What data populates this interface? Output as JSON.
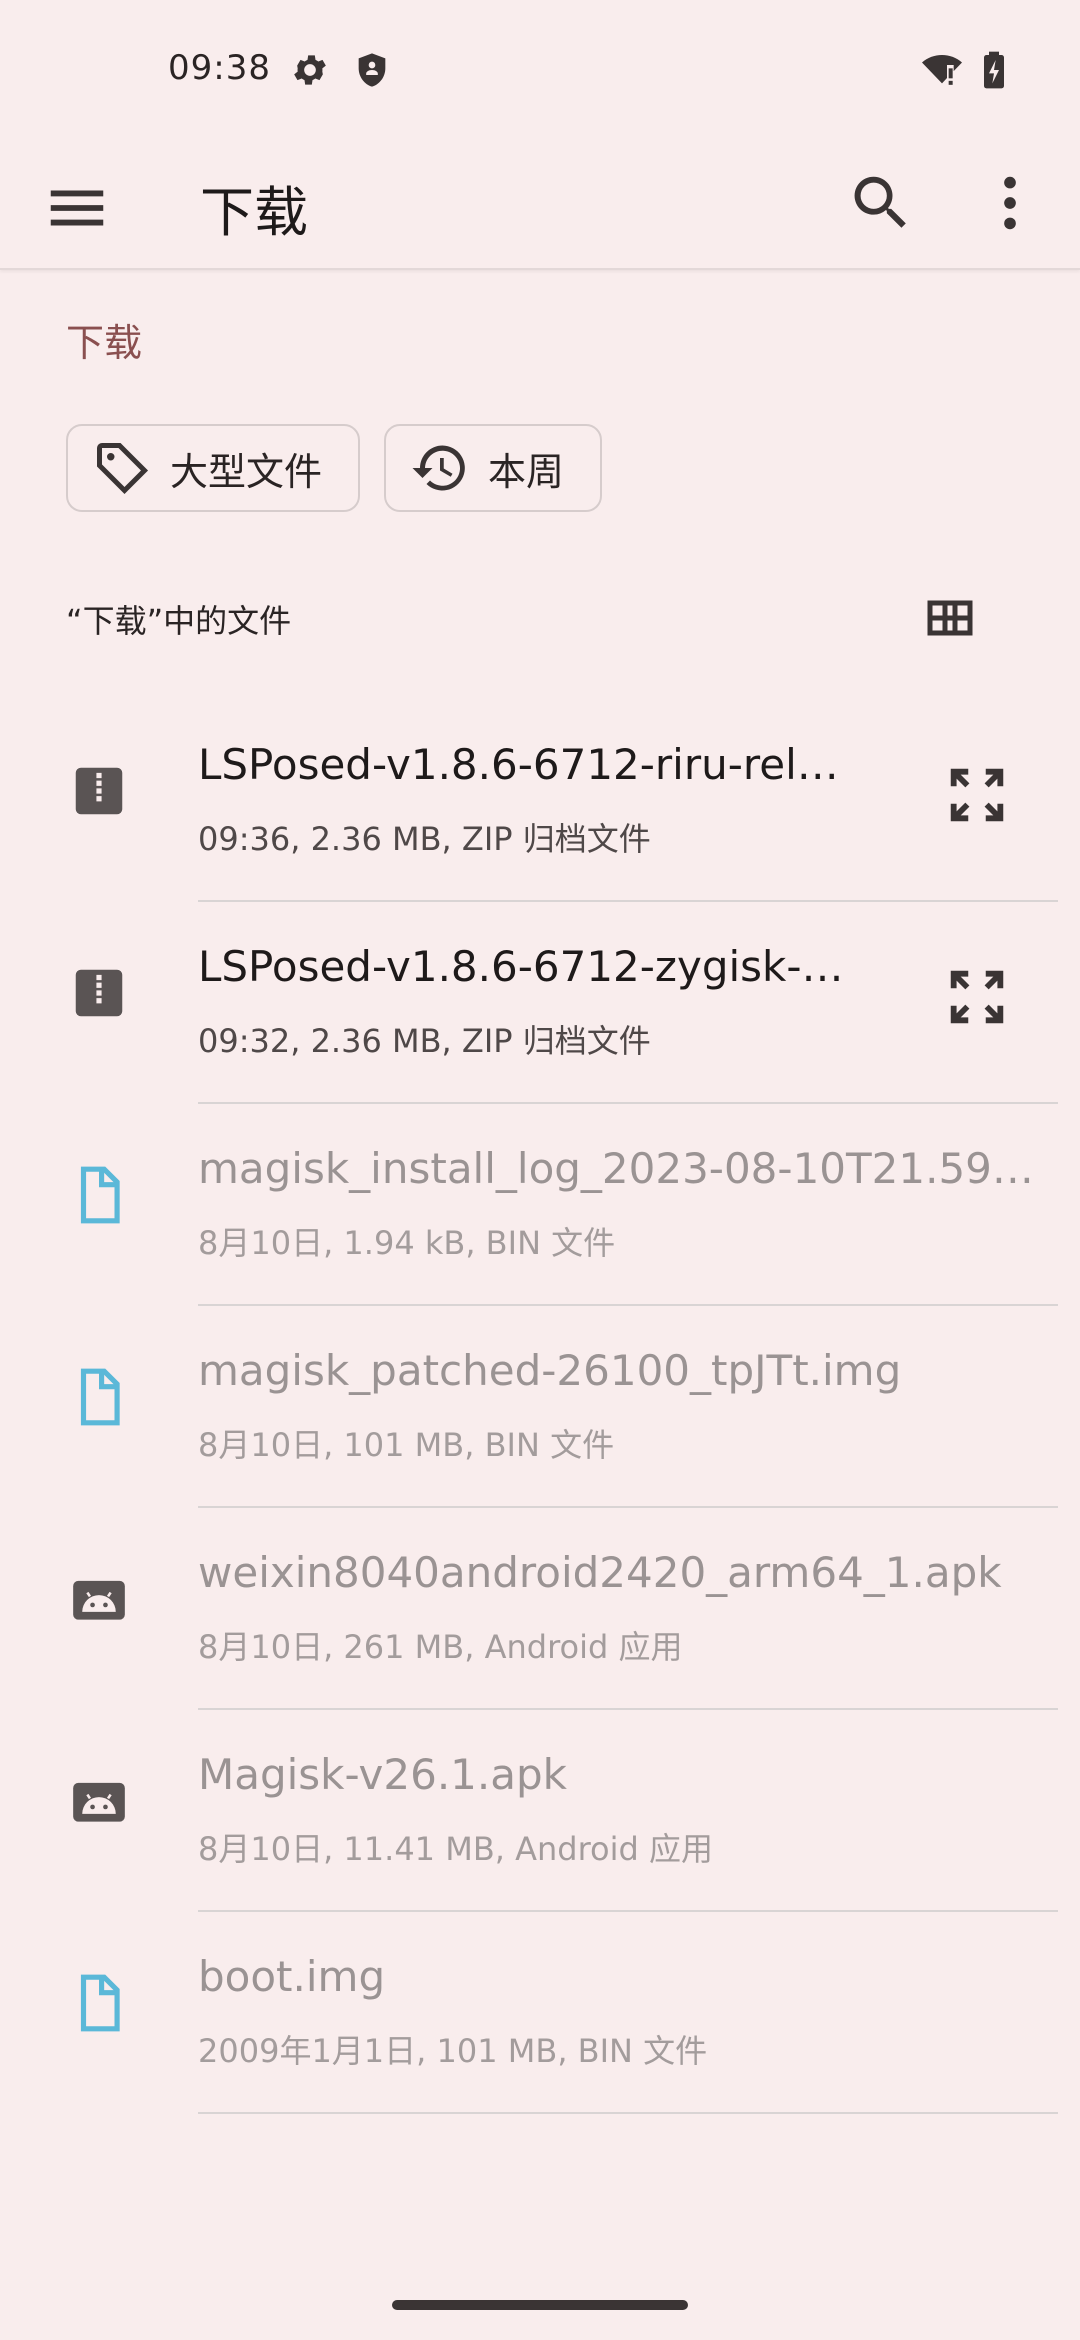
{
  "status_bar": {
    "time": "09:38"
  },
  "app_bar": {
    "title": "下载"
  },
  "breadcrumb": "下载",
  "chips": [
    {
      "label": "大型文件",
      "icon": "tag-icon"
    },
    {
      "label": "本周",
      "icon": "history-icon"
    }
  ],
  "section_header": "“下载”中的文件",
  "files": [
    {
      "name": "LSPosed-v1.8.6-6712-riru-relea...",
      "meta": "09:36, 2.36 MB, ZIP 归档文件",
      "icon": "zip-icon",
      "enabled": true
    },
    {
      "name": "LSPosed-v1.8.6-6712-zygisk-re...",
      "meta": "09:32, 2.36 MB, ZIP 归档文件",
      "icon": "zip-icon",
      "enabled": true
    },
    {
      "name": "magisk_install_log_2023-08-10T21.59.28.l...",
      "meta": "8月10日, 1.94 kB, BIN 文件",
      "icon": "file-icon",
      "enabled": false
    },
    {
      "name": "magisk_patched-26100_tpJTt.img",
      "meta": "8月10日, 101 MB, BIN 文件",
      "icon": "file-icon",
      "enabled": false
    },
    {
      "name": "weixin8040android2420_arm64_1.apk",
      "meta": "8月10日, 261 MB, Android 应用",
      "icon": "android-icon",
      "enabled": false
    },
    {
      "name": "Magisk-v26.1.apk",
      "meta": "8月10日, 11.41 MB, Android 应用",
      "icon": "android-icon",
      "enabled": false
    },
    {
      "name": "boot.img",
      "meta": "2009年1月1日, 101 MB, BIN 文件",
      "icon": "file-icon",
      "enabled": false
    }
  ],
  "colors": {
    "background": "#f9eded",
    "accent": "#8a4f4f",
    "file_icon": "#5bb8d8",
    "zip_icon": "#5a5454"
  }
}
